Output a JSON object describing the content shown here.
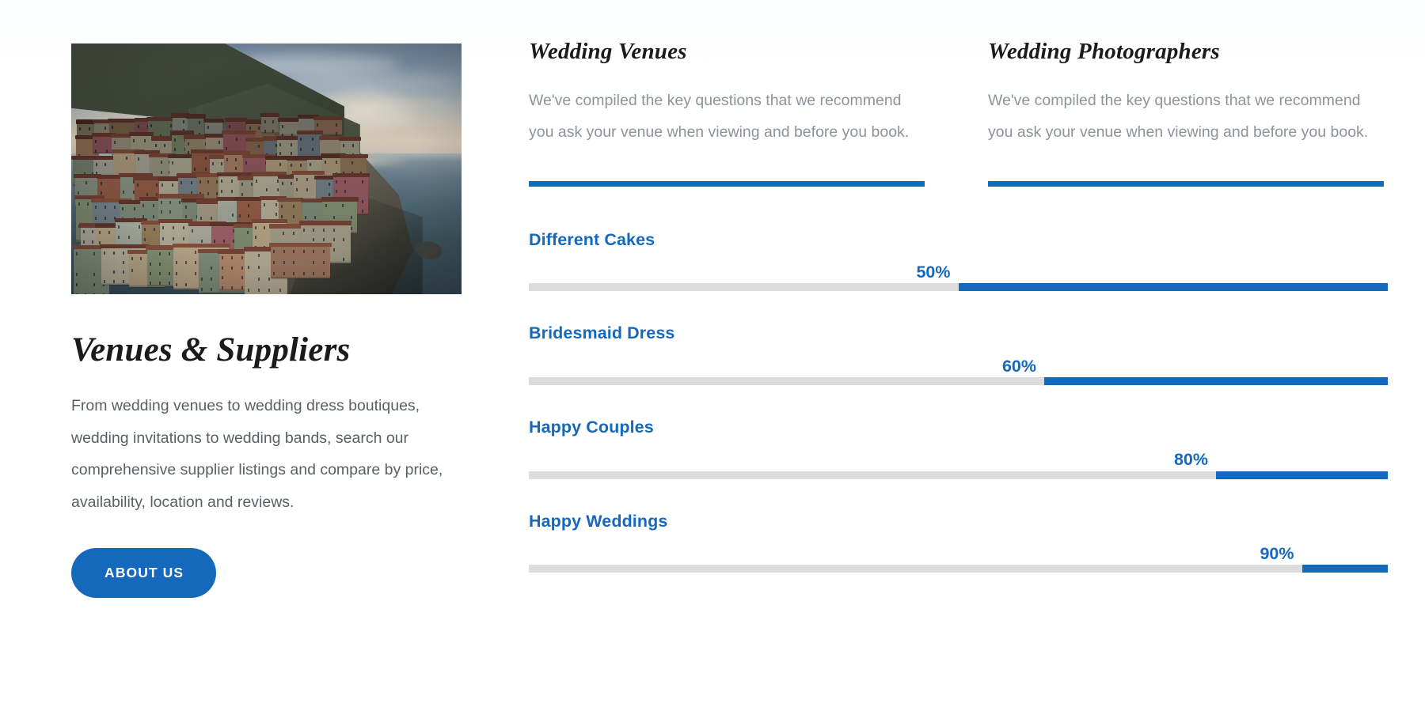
{
  "left": {
    "image_alt": "coastal-village-cliffside-photo",
    "title": "Venues & Suppliers",
    "body": "From wedding venues to wedding dress boutiques, wedding invitations to wedding bands, search our comprehensive supplier listings and compare by price, availability, location and reviews.",
    "cta_label": "ABOUT US"
  },
  "info_cards": [
    {
      "title": "Wedding Venues",
      "body": "We've compiled the key questions that we recommend you ask your venue when viewing and before you book."
    },
    {
      "title": "Wedding Photographers",
      "body": "We've compiled the key questions that we recommend you ask your venue when viewing and before you book."
    }
  ],
  "chart_data": {
    "type": "bar",
    "title": "",
    "orientation": "horizontal",
    "categories": [
      "Different Cakes",
      "Bridesmaid Dress",
      "Happy Couples",
      "Happy Weddings"
    ],
    "values": [
      50,
      60,
      80,
      90
    ],
    "value_labels": [
      "50%",
      "60%",
      "80%",
      "90%"
    ],
    "xlabel": "",
    "ylabel": "",
    "xlim": [
      0,
      100
    ],
    "grid": false,
    "legend": null,
    "unit": "%"
  },
  "skills": [
    {
      "name": "Different Cakes",
      "percent_label": "50%",
      "percent": 50
    },
    {
      "name": "Bridesmaid Dress",
      "percent_label": "60%",
      "percent": 60
    },
    {
      "name": "Happy Couples",
      "percent_label": "80%",
      "percent": 80
    },
    {
      "name": "Happy Weddings",
      "percent_label": "90%",
      "percent": 90
    }
  ],
  "colors": {
    "accent_blue": "#1569bd",
    "track_grey": "#dcdcdc",
    "heading": "#1b1b1b",
    "body_text": "#5b6066",
    "muted_text": "#8e9399"
  }
}
